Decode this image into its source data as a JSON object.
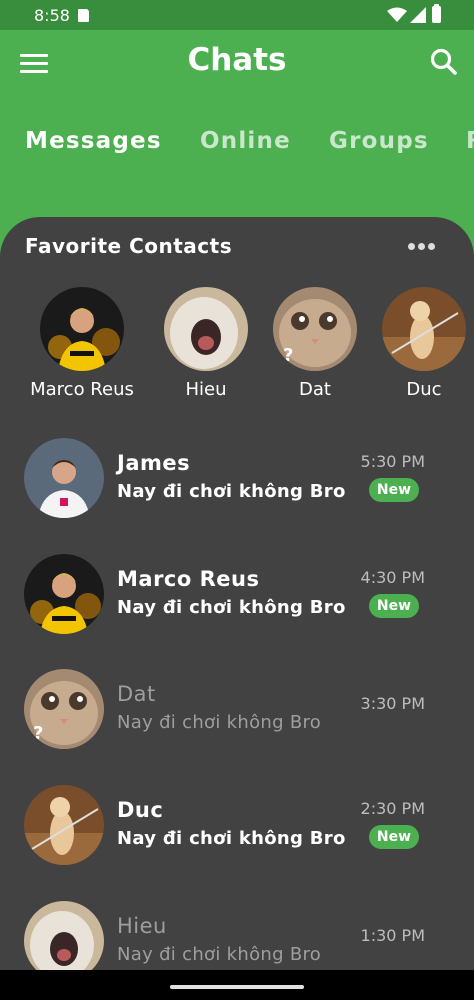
{
  "status_bar": {
    "time": "8:58",
    "icons": [
      "sd-card-icon",
      "wifi-icon",
      "signal-icon",
      "battery-icon"
    ]
  },
  "app_bar": {
    "title": "Chats",
    "menu_icon": "menu-icon",
    "search_icon": "search-icon"
  },
  "tabs": [
    {
      "label": "Messages",
      "active": true
    },
    {
      "label": "Online",
      "active": false
    },
    {
      "label": "Groups",
      "active": false
    },
    {
      "label": "R",
      "active": false
    }
  ],
  "favorites": {
    "title": "Favorite Contacts",
    "more_icon": "more-horizontal-icon",
    "contacts": [
      {
        "name": "Marco Reus"
      },
      {
        "name": "Hieu"
      },
      {
        "name": "Dat"
      },
      {
        "name": "Duc"
      }
    ]
  },
  "chats": [
    {
      "name": "James",
      "message": "Nay đi chơi không Bro",
      "time": "5:30 PM",
      "unread": true,
      "badge": "New"
    },
    {
      "name": "Marco Reus",
      "message": "Nay đi chơi không Bro",
      "time": "4:30 PM",
      "unread": true,
      "badge": "New"
    },
    {
      "name": "Dat",
      "message": "Nay đi chơi không Bro",
      "time": "3:30 PM",
      "unread": false
    },
    {
      "name": "Duc",
      "message": "Nay đi chơi không Bro",
      "time": "2:30 PM",
      "unread": true,
      "badge": "New"
    },
    {
      "name": "Hieu",
      "message": "Nay đi chơi không Bro",
      "time": "1:30 PM",
      "unread": false
    }
  ],
  "colors": {
    "primary": "#4CAF50",
    "primary_dark": "#388E3C",
    "panel": "#424242",
    "badge": "#4CAF50"
  }
}
